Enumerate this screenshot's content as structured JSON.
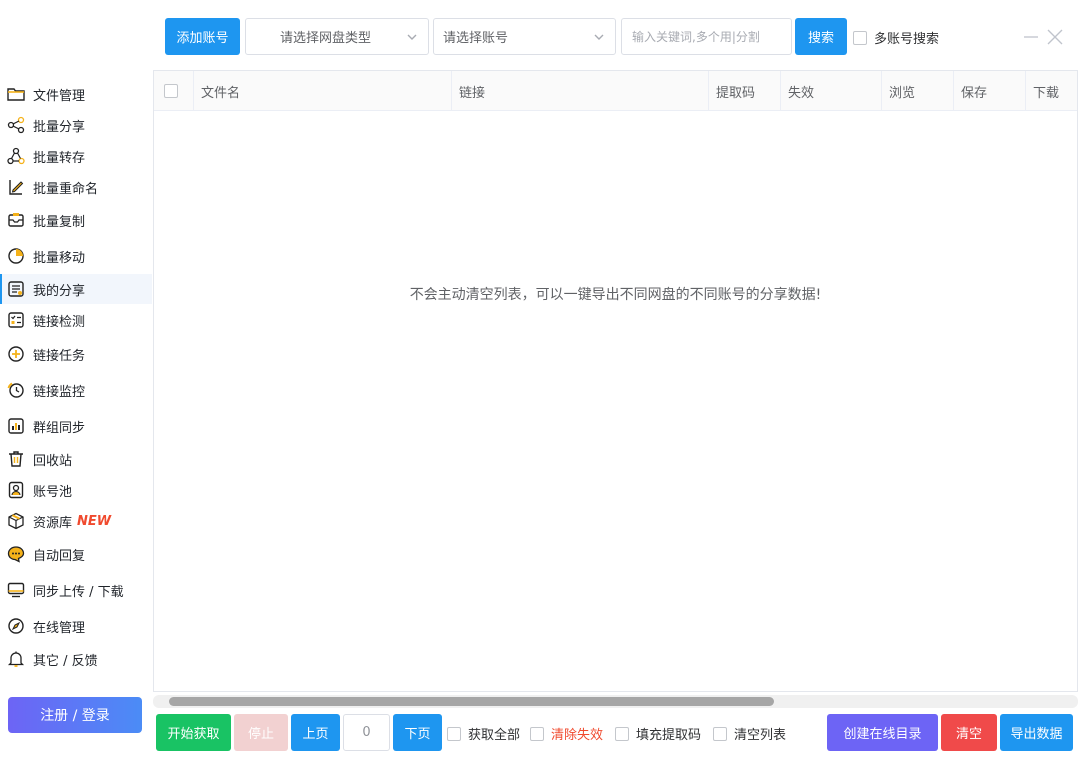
{
  "toolbar": {
    "add_account_label": "添加账号",
    "disk_type_placeholder": "请选择网盘类型",
    "account_placeholder": "请选择账号",
    "keyword_placeholder": "输入关键词,多个用|分割",
    "search_label": "搜索",
    "multi_account_label": "多账号搜索"
  },
  "sidebar": {
    "items": [
      {
        "label": "文件管理",
        "icon": "folder-icon"
      },
      {
        "label": "批量分享",
        "icon": "share-icon"
      },
      {
        "label": "批量转存",
        "icon": "transfer-icon"
      },
      {
        "label": "批量重命名",
        "icon": "rename-icon"
      },
      {
        "label": "批量复制",
        "icon": "copy-icon"
      },
      {
        "label": "批量移动",
        "icon": "move-icon"
      },
      {
        "label": "我的分享",
        "icon": "my-share-icon"
      },
      {
        "label": "链接检测",
        "icon": "link-check-icon"
      },
      {
        "label": "链接任务",
        "icon": "plus-circle-icon"
      },
      {
        "label": "链接监控",
        "icon": "clock-icon"
      },
      {
        "label": "群组同步",
        "icon": "chart-icon"
      },
      {
        "label": "回收站",
        "icon": "trash-icon"
      },
      {
        "label": "账号池",
        "icon": "user-card-icon"
      },
      {
        "label": "资源库",
        "icon": "box-icon",
        "badge": "NEW"
      },
      {
        "label": "自动回复",
        "icon": "chat-icon"
      },
      {
        "label": "同步上传 / 下载",
        "icon": "monitor-icon"
      },
      {
        "label": "在线管理",
        "icon": "compass-icon"
      },
      {
        "label": "其它 / 反馈",
        "icon": "bell-icon"
      }
    ],
    "active_label": "我的分享",
    "login_label": "注册 / 登录"
  },
  "table": {
    "columns": [
      "文件名",
      "链接",
      "提取码",
      "失效",
      "浏览",
      "保存",
      "下载"
    ],
    "empty_text": "不会主动清空列表，可以一键导出不同网盘的不同账号的分享数据!"
  },
  "bottom": {
    "start_label": "开始获取",
    "stop_label": "停止",
    "prev_label": "上页",
    "page_value": "0",
    "next_label": "下页",
    "fetch_all_label": "获取全部",
    "clear_invalid_label": "清除失效",
    "fill_code_label": "填充提取码",
    "clear_list_label": "清空列表",
    "create_dir_label": "创建在线目录",
    "clear_label": "清空",
    "export_label": "导出数据"
  },
  "colors": {
    "primary": "#1e96f0",
    "green": "#19c364",
    "stop_disabled": "#f2d1d1",
    "purple": "#6d64f5",
    "red": "#f04a4a",
    "danger_text": "#f04a2e"
  }
}
